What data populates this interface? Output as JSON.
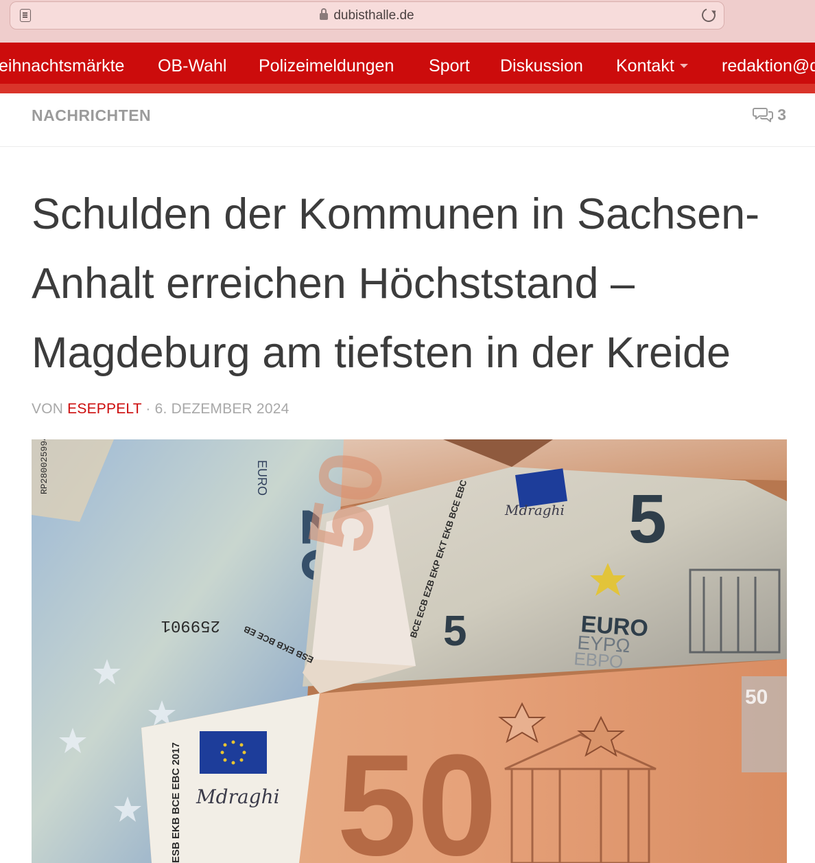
{
  "browser": {
    "url": "dubisthalle.de",
    "icons": [
      "reader-icon",
      "lock-icon",
      "reload-icon"
    ]
  },
  "nav": {
    "items": [
      {
        "label": "eihnachtsmärkte"
      },
      {
        "label": "OB-Wahl"
      },
      {
        "label": "Polizeimeldungen"
      },
      {
        "label": "Sport"
      },
      {
        "label": "Diskussion"
      },
      {
        "label": "Kontakt",
        "has_dropdown": true
      },
      {
        "label": "redaktion@d"
      }
    ],
    "colors": {
      "bar": "#cc0c0c",
      "text": "#ffffff"
    }
  },
  "article": {
    "category": "NACHRICHTEN",
    "comment_count": "3",
    "title_lines": [
      "Schulden der Kommunen in Sachsen-",
      "Anhalt erreichen Höchststand –",
      "Magdeburg am tiefsten in der Kreide"
    ],
    "byline": {
      "prefix": "VON",
      "author": "ESEPPELT",
      "separator": "·",
      "date": "6. DEZEMBER 2024"
    }
  },
  "image": {
    "banknote_texts": {
      "serial_20": "RP2800259941",
      "serial_20_rev": "259901",
      "value_20": "20",
      "value_5": "5",
      "value_50": "50",
      "euro": "EURO",
      "eypo": "EYPΩ",
      "ebpo": "ЕВРО",
      "bank_line": "BCE ECB EZB EKP EKT EKB BCE EBC",
      "bank_line_2017": "ESB EKB BCE EBC 2017",
      "ecb_rev": "ESB EKB BCE EB",
      "signature": "Mdraghi"
    }
  }
}
